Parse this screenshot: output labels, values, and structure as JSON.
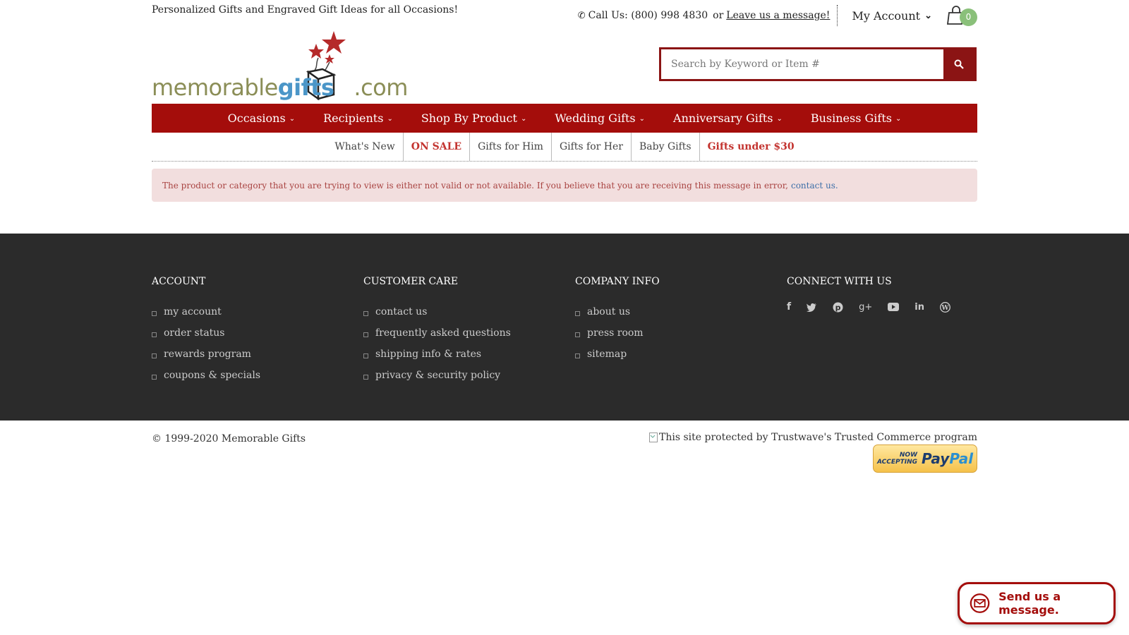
{
  "header": {
    "tagline": "Personalized Gifts and Engraved Gift Ideas for all Occasions!",
    "phone": "Call Us: (800) 998 4830",
    "or": "or",
    "message_link": "Leave us a message!",
    "account": "My Account",
    "cart_count": "0"
  },
  "logo": {
    "part1": "memorable",
    "part2": "gifts",
    "part3": ".com"
  },
  "search": {
    "placeholder": "Search by Keyword or Item #"
  },
  "main_nav": [
    "Occasions",
    "Recipients",
    "Shop By Product",
    "Wedding Gifts",
    "Anniversary Gifts",
    "Business Gifts"
  ],
  "sub_nav": [
    "What's New",
    "ON SALE",
    "Gifts for Him",
    "Gifts for Her",
    "Baby Gifts",
    "Gifts under $30"
  ],
  "alert": {
    "text": "The product or category that you are trying to view is either not valid or not available. If you believe that you are receiving this message in error,",
    "link": "contact us."
  },
  "footer": {
    "account": {
      "title": "ACCOUNT",
      "links": [
        "my account",
        "order status",
        "rewards program",
        "coupons & specials"
      ]
    },
    "customer_care": {
      "title": "CUSTOMER CARE",
      "links": [
        "contact us",
        "frequently asked questions",
        "shipping info & rates",
        "privacy & security policy"
      ]
    },
    "company_info": {
      "title": "COMPANY INFO",
      "links": [
        "about us",
        "press room",
        "sitemap"
      ]
    },
    "connect": {
      "title": "CONNECT WITH US",
      "icons": [
        "facebook-icon",
        "twitter-icon",
        "pinterest-icon",
        "google-plus-icon",
        "youtube-icon",
        "linkedin-icon",
        "wordpress-icon"
      ]
    }
  },
  "bottom": {
    "copyright": "© 1999-2020 Memorable Gifts",
    "trust_alt": "This site protected by Trustwave's Trusted Commerce program",
    "paypal_now": "NOW",
    "paypal_accepting": "ACCEPTING",
    "paypal_pay": "Pay",
    "paypal_pal": "Pal"
  },
  "chat": {
    "label": "Send us a message."
  },
  "colors": {
    "brand_red": "#a40d0b",
    "footer_bg": "#2b2b2b",
    "alert_bg": "#f2dede",
    "badge_green": "#8ac07a"
  }
}
